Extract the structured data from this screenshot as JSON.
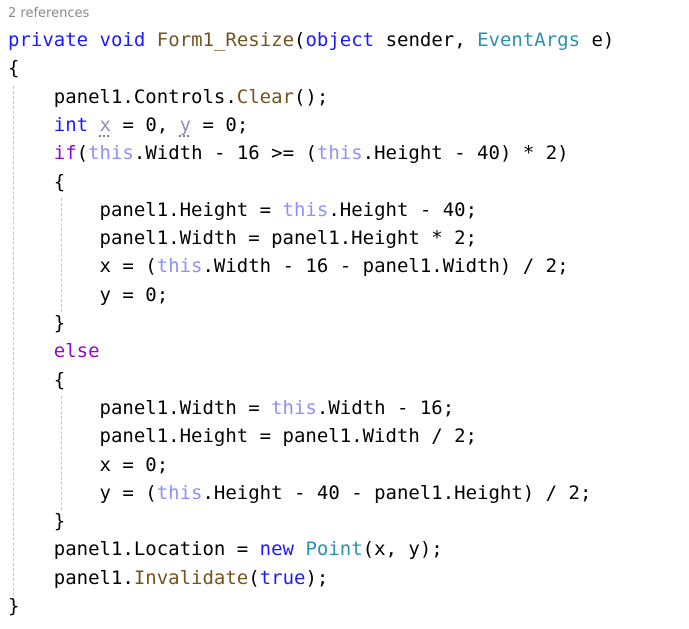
{
  "codelens": "2 references",
  "lines": [
    {
      "tokens": [
        {
          "t": "private",
          "c": "kw"
        },
        {
          "t": " "
        },
        {
          "t": "void",
          "c": "kw"
        },
        {
          "t": " "
        },
        {
          "t": "Form1_Resize",
          "c": "method"
        },
        {
          "t": "("
        },
        {
          "t": "object",
          "c": "kw"
        },
        {
          "t": " sender, "
        },
        {
          "t": "EventArgs",
          "c": "type"
        },
        {
          "t": " e)"
        }
      ]
    },
    {
      "tokens": [
        {
          "t": "{"
        }
      ]
    },
    {
      "tokens": [
        {
          "t": "    panel1.Controls."
        },
        {
          "t": "Clear",
          "c": "method"
        },
        {
          "t": "();"
        }
      ]
    },
    {
      "tokens": [
        {
          "t": "    "
        },
        {
          "t": "int",
          "c": "kw"
        },
        {
          "t": " "
        },
        {
          "t": "x",
          "c": "dim"
        },
        {
          "t": " = 0, "
        },
        {
          "t": "y",
          "c": "dim"
        },
        {
          "t": " = 0;"
        }
      ]
    },
    {
      "tokens": [
        {
          "t": "    "
        },
        {
          "t": "if",
          "c": "ctrl"
        },
        {
          "t": "("
        },
        {
          "t": "this",
          "c": "this"
        },
        {
          "t": ".Width - 16 >= ("
        },
        {
          "t": "this",
          "c": "this"
        },
        {
          "t": ".Height - 40) * 2)"
        }
      ]
    },
    {
      "tokens": [
        {
          "t": "    {"
        }
      ]
    },
    {
      "tokens": [
        {
          "t": "        panel1.Height = "
        },
        {
          "t": "this",
          "c": "this"
        },
        {
          "t": ".Height - 40;"
        }
      ]
    },
    {
      "tokens": [
        {
          "t": "        panel1.Width = panel1.Height * 2;"
        }
      ]
    },
    {
      "tokens": [
        {
          "t": "        x = ("
        },
        {
          "t": "this",
          "c": "this"
        },
        {
          "t": ".Width - 16 - panel1.Width) / 2;"
        }
      ]
    },
    {
      "tokens": [
        {
          "t": "        y = 0;"
        }
      ]
    },
    {
      "tokens": [
        {
          "t": "    }"
        }
      ]
    },
    {
      "tokens": [
        {
          "t": "    "
        },
        {
          "t": "else",
          "c": "ctrl"
        }
      ]
    },
    {
      "tokens": [
        {
          "t": "    {"
        }
      ]
    },
    {
      "tokens": [
        {
          "t": "        panel1.Width = "
        },
        {
          "t": "this",
          "c": "this"
        },
        {
          "t": ".Width - 16;"
        }
      ]
    },
    {
      "tokens": [
        {
          "t": "        panel1.Height = panel1.Width / 2;"
        }
      ]
    },
    {
      "tokens": [
        {
          "t": "        x = 0;"
        }
      ]
    },
    {
      "tokens": [
        {
          "t": "        y = ("
        },
        {
          "t": "this",
          "c": "this"
        },
        {
          "t": ".Height - 40 - panel1.Height) / 2;"
        }
      ]
    },
    {
      "tokens": [
        {
          "t": "    }"
        }
      ]
    },
    {
      "tokens": [
        {
          "t": "    panel1.Location = "
        },
        {
          "t": "new",
          "c": "kw"
        },
        {
          "t": " "
        },
        {
          "t": "Point",
          "c": "type"
        },
        {
          "t": "(x, y);"
        }
      ]
    },
    {
      "tokens": [
        {
          "t": "    panel1."
        },
        {
          "t": "Invalidate",
          "c": "method"
        },
        {
          "t": "("
        },
        {
          "t": "true",
          "c": "kw"
        },
        {
          "t": ");"
        }
      ]
    },
    {
      "tokens": [
        {
          "t": "}"
        }
      ]
    }
  ]
}
